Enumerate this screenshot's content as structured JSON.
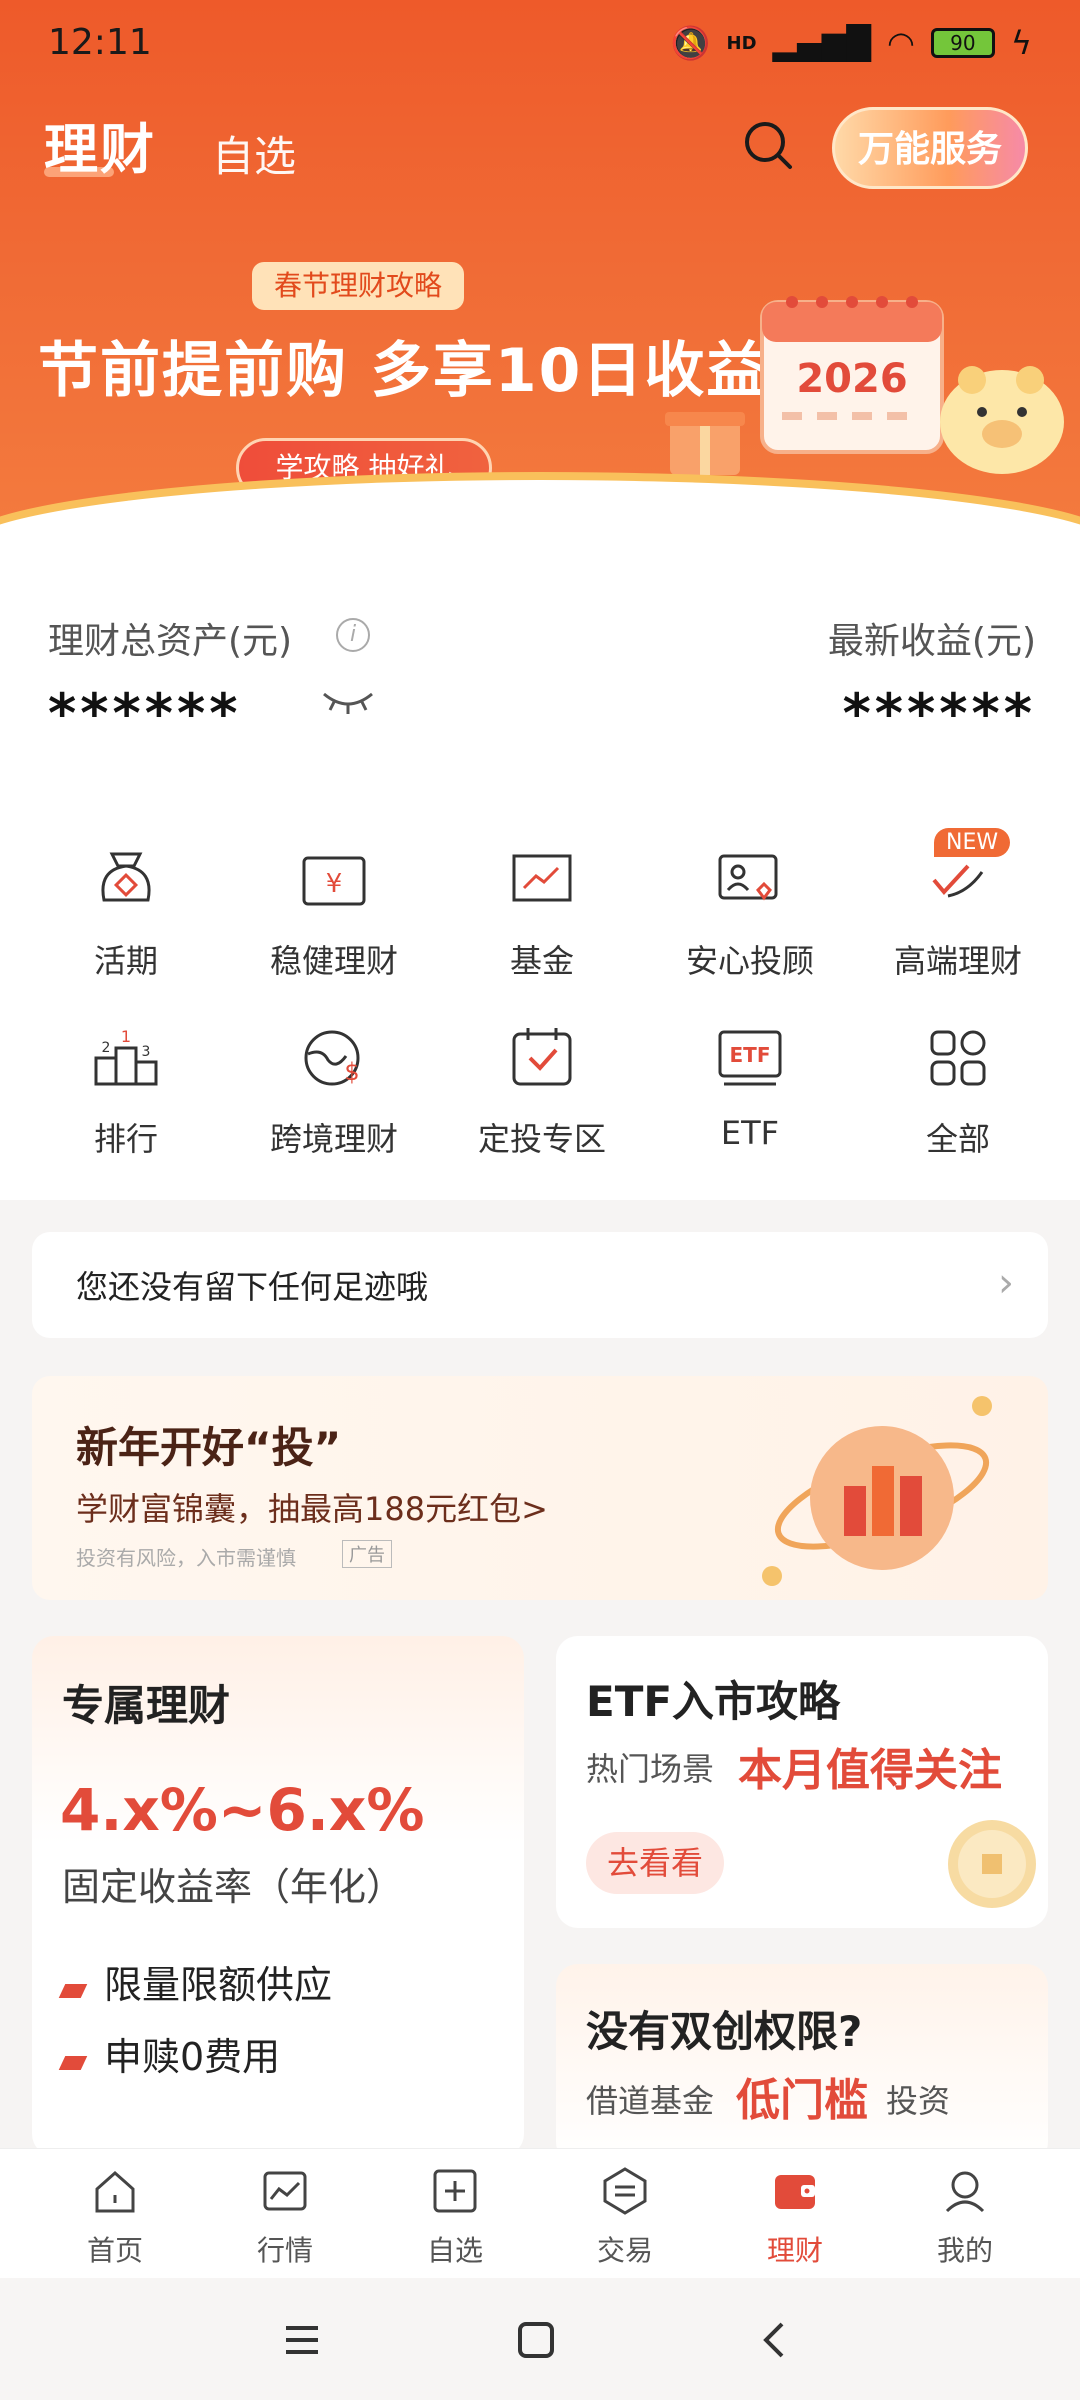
{
  "status_bar": {
    "time": "12:11",
    "network": "HD",
    "battery": "90"
  },
  "header": {
    "tab_main": "理财",
    "tab_sub": "自选",
    "service_button": "万能服务"
  },
  "banner": {
    "tag": "春节理财攻略",
    "title": "节前提前购 多享10日收益",
    "button": "学攻略 抽好礼",
    "calendar_year": "2026"
  },
  "assets": {
    "total_label": "理财总资产(元)",
    "total_value": "******",
    "income_label": "最新收益(元)",
    "income_value": "******"
  },
  "grid": {
    "new_badge": "NEW",
    "items": [
      {
        "label": "活期",
        "icon": "bag-icon"
      },
      {
        "label": "稳健理财",
        "icon": "wallet-icon"
      },
      {
        "label": "基金",
        "icon": "chart-icon"
      },
      {
        "label": "安心投顾",
        "icon": "advisor-icon"
      },
      {
        "label": "高端理财",
        "icon": "premium-icon"
      },
      {
        "label": "排行",
        "icon": "podium-icon"
      },
      {
        "label": "跨境理财",
        "icon": "globe-dollar-icon"
      },
      {
        "label": "定投专区",
        "icon": "calendar-check-icon"
      },
      {
        "label": "ETF",
        "icon": "etf-icon"
      },
      {
        "label": "全部",
        "icon": "grid-icon"
      }
    ]
  },
  "footprint": {
    "text": "您还没有留下任何足迹哦"
  },
  "ad": {
    "title": "新年开好“投”",
    "subtitle": "学财富锦囊，抽最高188元红包>",
    "disclaimer": "投资有风险，入市需谨慎",
    "ad_tag": "广告"
  },
  "card_exclusive": {
    "title": "专属理财",
    "rate": "4.x%~6.x%",
    "rate_desc": "固定收益率（年化）",
    "features": [
      "限量限额供应",
      "申赎0费用"
    ]
  },
  "card_etf": {
    "title": "ETF入市攻略",
    "sub": "热门场景",
    "highlight": "本月值得关注",
    "button": "去看看"
  },
  "card_fund": {
    "title": "没有双创权限?",
    "s1": "借道基金",
    "highlight": "低门槛",
    "s2": "投资"
  },
  "tabbar": {
    "items": [
      "首页",
      "行情",
      "自选",
      "交易",
      "理财",
      "我的"
    ],
    "active_index": 4
  },
  "colors": {
    "brand": "#ee5a2a",
    "accent_red": "#e24b3a"
  }
}
